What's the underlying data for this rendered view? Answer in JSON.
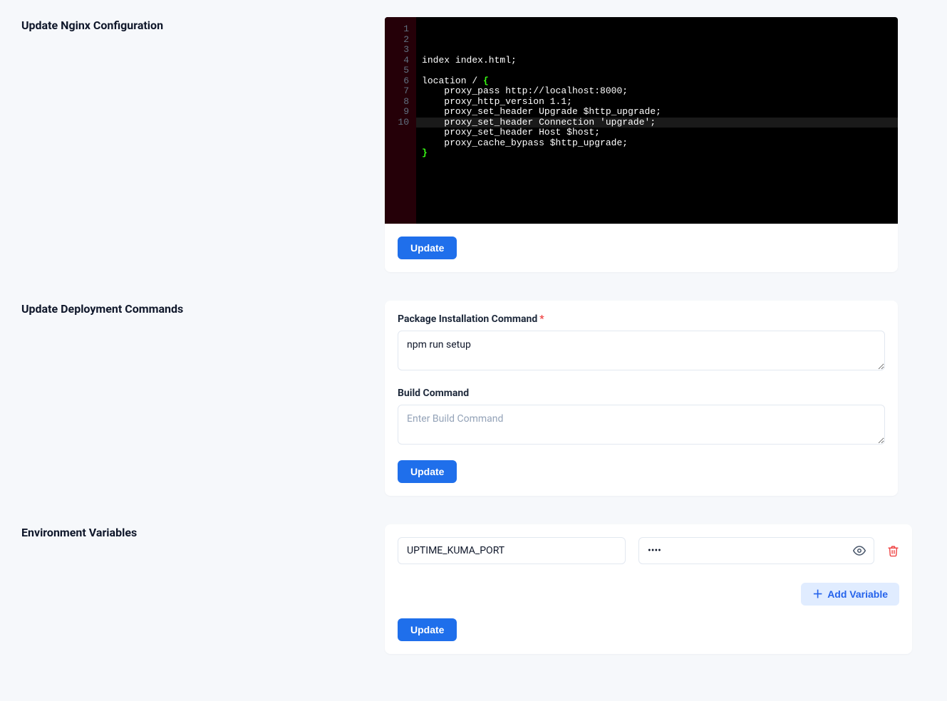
{
  "sections": {
    "nginx": {
      "title": "Update Nginx Configuration",
      "update_button": "Update",
      "code_lines": [
        "index index.html;",
        "",
        "location / {",
        "    proxy_pass http://localhost:8000;",
        "    proxy_http_version 1.1;",
        "    proxy_set_header Upgrade $http_upgrade;",
        "    proxy_set_header Connection 'upgrade';",
        "    proxy_set_header Host $host;",
        "    proxy_cache_bypass $http_upgrade;",
        "}"
      ]
    },
    "deploy": {
      "title": "Update Deployment Commands",
      "install_label": "Package Installation Command",
      "install_value": "npm run setup",
      "build_label": "Build Command",
      "build_placeholder": "Enter Build Command",
      "build_value": "",
      "update_button": "Update"
    },
    "env": {
      "title": "Environment Variables",
      "vars": [
        {
          "key": "UPTIME_KUMA_PORT",
          "value": "••••"
        }
      ],
      "add_label": "Add Variable",
      "update_button": "Update"
    }
  },
  "colors": {
    "primary": "#1f6feb",
    "danger": "#ef4444",
    "bg": "#f6f8fb"
  }
}
